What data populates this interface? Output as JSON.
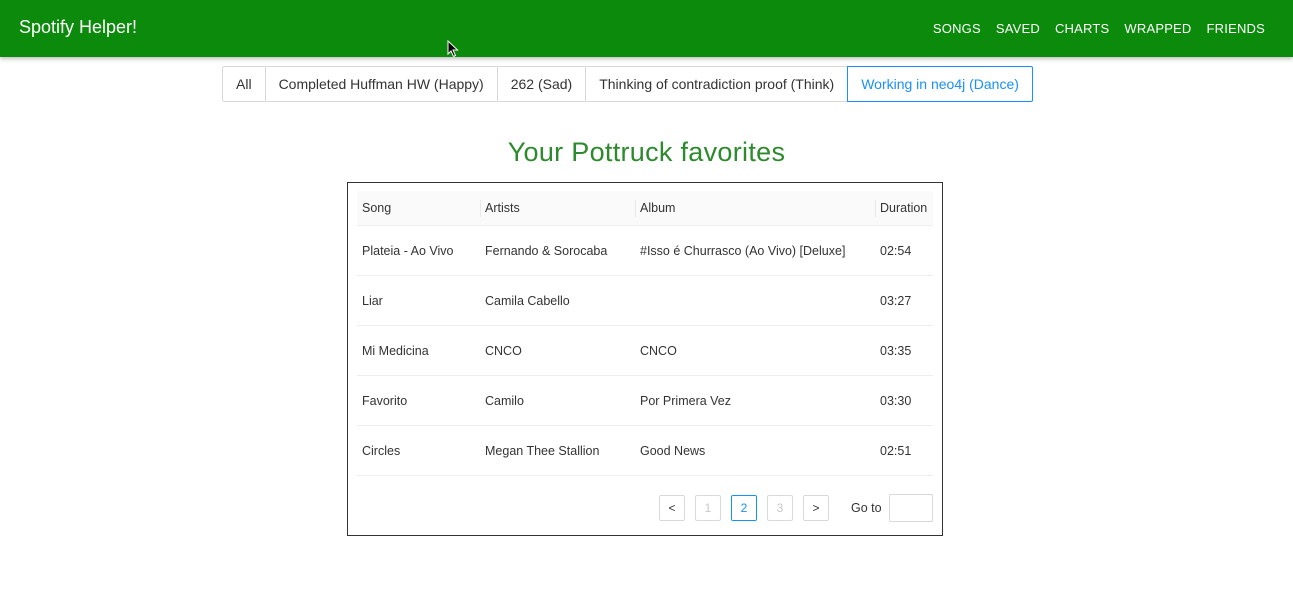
{
  "app": {
    "brand": "Spotify Helper!"
  },
  "nav": {
    "items": [
      "SONGS",
      "SAVED",
      "CHARTS",
      "WRAPPED",
      "FRIENDS"
    ]
  },
  "filter_tabs": {
    "items": [
      "All",
      "Completed Huffman HW (Happy)",
      "262 (Sad)",
      "Thinking of contradiction proof (Think)",
      "Working in neo4j (Dance)"
    ],
    "active_index": 4
  },
  "main": {
    "title": "Your Pottruck favorites"
  },
  "table": {
    "columns": [
      "Song",
      "Artists",
      "Album",
      "Duration"
    ],
    "rows": [
      [
        "Plateia - Ao Vivo",
        "Fernando & Sorocaba",
        "#Isso é Churrasco (Ao Vivo) [Deluxe]",
        "02:54"
      ],
      [
        "Liar",
        "Camila Cabello",
        "",
        "03:27"
      ],
      [
        "Mi Medicina",
        "CNCO",
        "CNCO",
        "03:35"
      ],
      [
        "Favorito",
        "Camilo",
        "Por Primera Vez",
        "03:30"
      ],
      [
        "Circles",
        "Megan Thee Stallion",
        "Good News",
        "02:51"
      ]
    ]
  },
  "pagination": {
    "prev": "<",
    "next": ">",
    "pages": [
      "1",
      "2",
      "3"
    ],
    "current": "2",
    "goto_label": "Go to",
    "goto_value": ""
  },
  "colors": {
    "brand_green": "#0b8a0b",
    "title_green": "#2d8a2d",
    "active_blue": "#1890ff"
  }
}
